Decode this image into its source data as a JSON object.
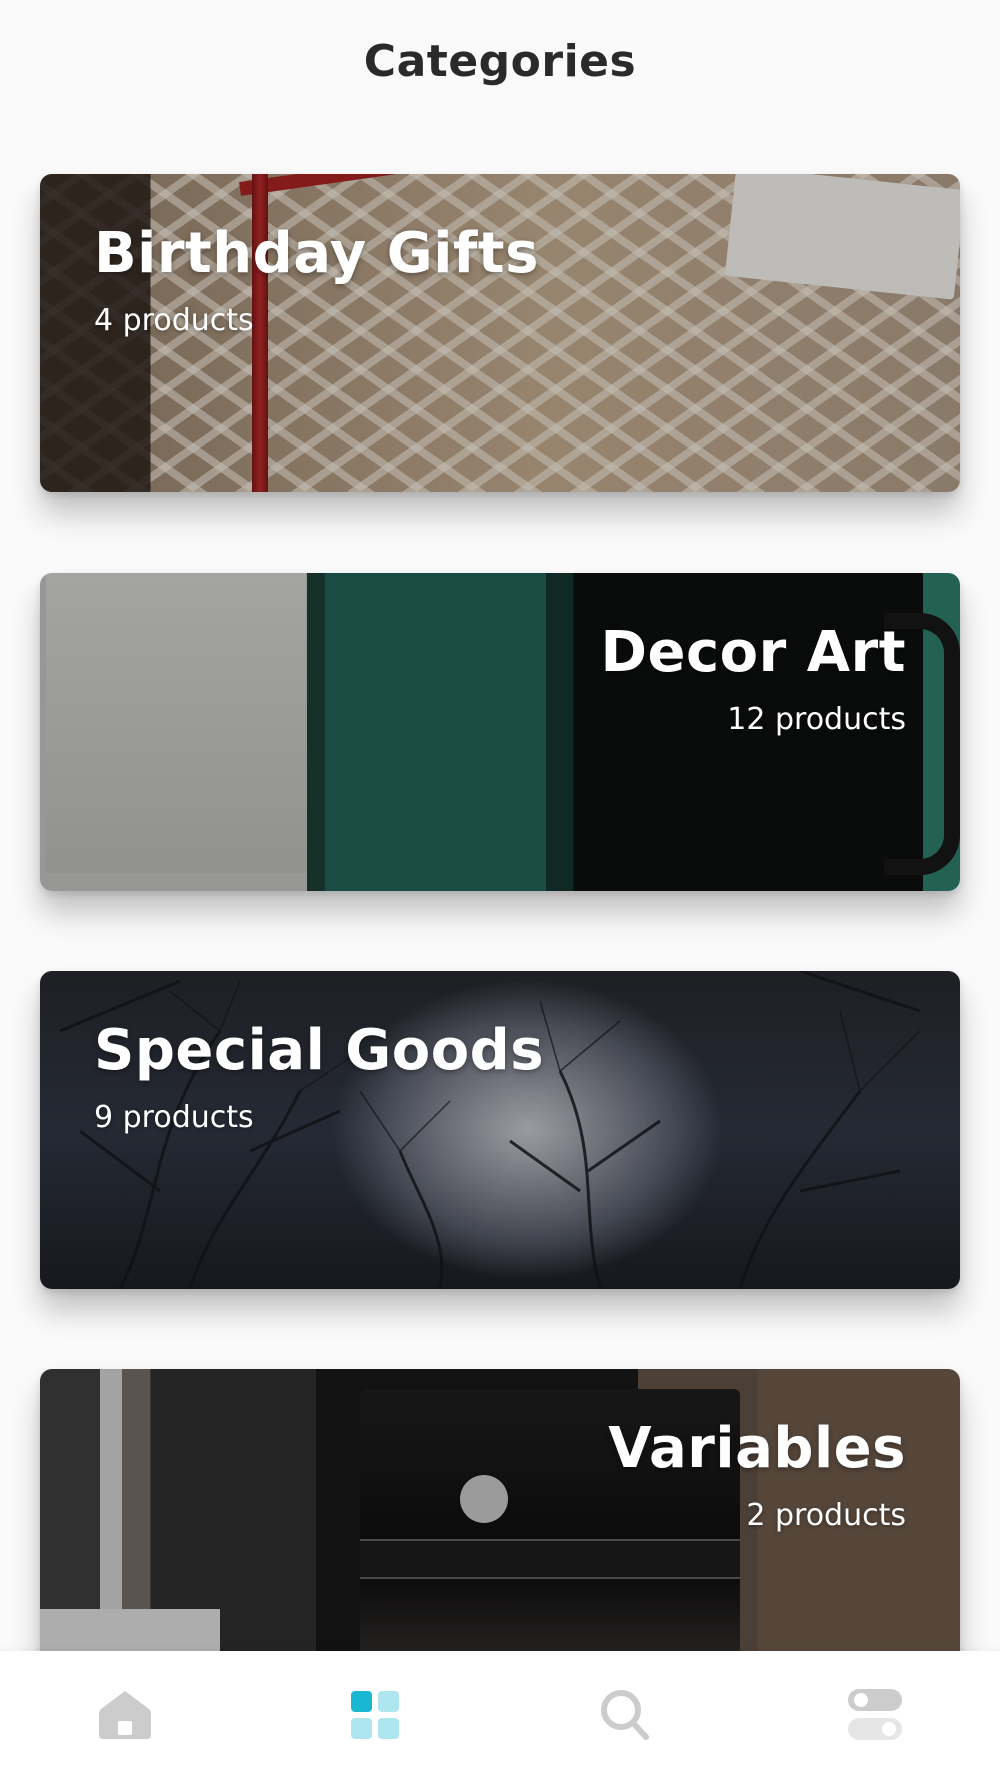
{
  "header": {
    "title": "Categories"
  },
  "categories": [
    {
      "title": "Birthday Gifts",
      "count": "4 products",
      "align": "left"
    },
    {
      "title": "Decor Art",
      "count": "12 products",
      "align": "right"
    },
    {
      "title": "Special Goods",
      "count": "9 products",
      "align": "left"
    },
    {
      "title": "Variables",
      "count": "2 products",
      "align": "right"
    }
  ],
  "bottom_nav": {
    "items": [
      {
        "icon": "home-icon",
        "active": false
      },
      {
        "icon": "grid-icon",
        "active": true
      },
      {
        "icon": "search-icon",
        "active": false
      },
      {
        "icon": "toggles-icon",
        "active": false
      }
    ],
    "active_color": "#1ab7d3",
    "active_light_color": "#aee6f0",
    "inactive_color": "#cccccc"
  }
}
